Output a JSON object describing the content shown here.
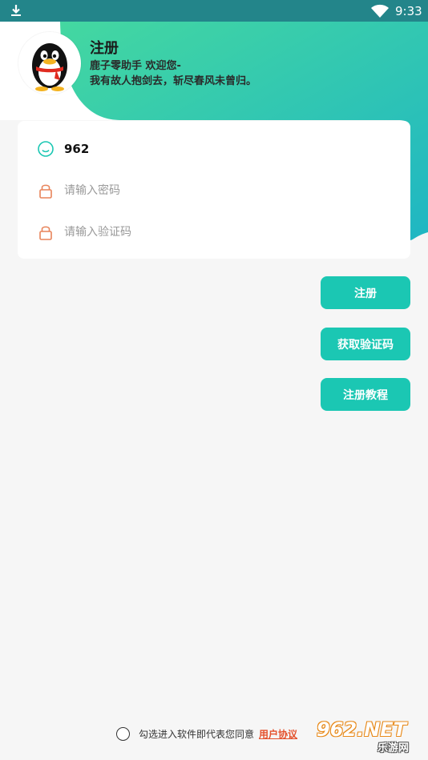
{
  "status_bar": {
    "time": "9:33",
    "download_icon": "download-icon",
    "wifi_icon": "wifi-icon"
  },
  "header": {
    "title": "注册",
    "subtitle1": "鹿子零助手 欢迎您-",
    "subtitle2": "我有故人抱剑去，斩尽春风未曾归。",
    "avatar_icon": "penguin-avatar-icon"
  },
  "form": {
    "username": {
      "value": "962",
      "icon": "smile-icon"
    },
    "password": {
      "placeholder": "请输入密码",
      "icon": "lock-icon"
    },
    "code": {
      "placeholder": "请输入验证码",
      "icon": "lock-icon"
    }
  },
  "buttons": {
    "register": "注册",
    "get_code": "获取验证码",
    "tutorial": "注册教程"
  },
  "agreement": {
    "text": "勾选进入软件即代表您同意",
    "link": "用户协议"
  },
  "watermark": {
    "main": "962.NET",
    "sub": "乐游网"
  },
  "colors": {
    "accent": "#1bc7b3",
    "gradient_start": "#3ad6a3",
    "gradient_end": "#22b9c0",
    "status_bar": "#23858a",
    "lock": "#e8845a",
    "link": "#e4512c"
  }
}
